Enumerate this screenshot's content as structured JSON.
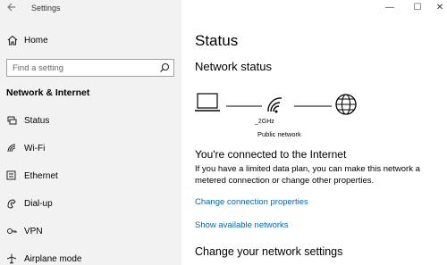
{
  "window": {
    "title": "Settings",
    "controls": {
      "minimize": "—",
      "maximize": "☐",
      "close": "✕"
    }
  },
  "sidebar": {
    "home_label": "Home",
    "search": {
      "placeholder": "Find a setting"
    },
    "section_title": "Network & Internet",
    "items": [
      {
        "label": "Status",
        "icon": "status-icon"
      },
      {
        "label": "Wi-Fi",
        "icon": "wifi-icon"
      },
      {
        "label": "Ethernet",
        "icon": "ethernet-icon"
      },
      {
        "label": "Dial-up",
        "icon": "dialup-icon"
      },
      {
        "label": "VPN",
        "icon": "vpn-icon"
      },
      {
        "label": "Airplane mode",
        "icon": "airplane-icon"
      }
    ]
  },
  "main": {
    "title": "Status",
    "network_status_heading": "Network status",
    "network": {
      "ssid": "_2GHz",
      "type": "Public network"
    },
    "connected_heading": "You're connected to the Internet",
    "description": "If you have a limited data plan, you can make this network a metered connection or change other properties.",
    "link_change_properties": "Change connection properties",
    "link_show_networks": "Show available networks",
    "change_settings_heading": "Change your network settings"
  },
  "colors": {
    "sidebar_bg": "#f2f2f2",
    "link": "#0067b8"
  }
}
